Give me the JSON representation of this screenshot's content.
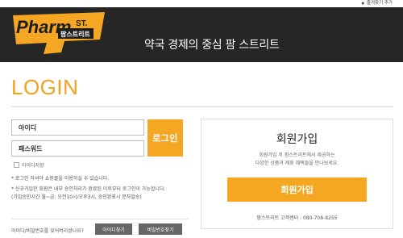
{
  "topbar": {
    "favorite_label": "즐겨찾기 추가"
  },
  "header": {
    "logo_text": "Pharm",
    "logo_st": "ST.",
    "logo_korean": "팜스트리트",
    "tagline": "약국 경제의 중심 팜 스트리트"
  },
  "login": {
    "title": "LOGIN",
    "id_placeholder": "아이디",
    "pw_placeholder": "패스워드",
    "login_button": "로그인",
    "save_id_label": "아이디저장",
    "notes": [
      "* 로그인 하셔야 쇼핑몰을 이용하실 수 있습니다.",
      "* 신규가입한 회원은 내부 승인처리가 완료된 이후부터 로그인이 가능합니다.",
      "(가입승인시간 월~금: 오전10시/오후3시, 승인완료시 문자발송)"
    ],
    "forgot_text": "아이디/비밀번호를 잊어버리셨나요?",
    "find_id_button": "아이디찾기",
    "find_pw_button": "비밀번호찾기"
  },
  "join": {
    "title": "회원가입",
    "desc_line1": "회원가입 후 팜스트리트에서 제공하는",
    "desc_line2": "다양한 상품과 제휴 혜택들을 만나보세요.",
    "button": "회원가입",
    "phone": "팜스트리트 고객센터 : 080-708-8255"
  },
  "colors": {
    "accent": "#f5a623",
    "header_bg": "#262626",
    "button_gray": "#666666"
  }
}
